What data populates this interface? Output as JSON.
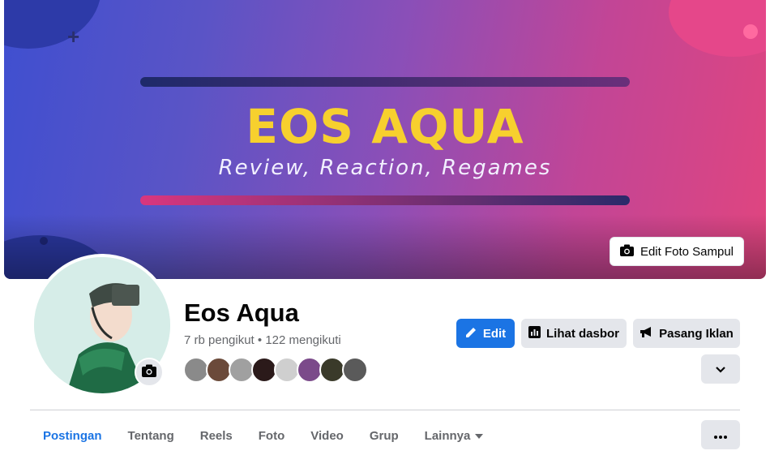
{
  "cover": {
    "title": "EOS AQUA",
    "subtitle": "Review, Reaction, Regames",
    "edit_label": "Edit Foto Sampul"
  },
  "profile": {
    "name": "Eos Aqua",
    "followers_text": "7 rb pengikut • 122 mengikuti"
  },
  "actions": {
    "edit_label": "Edit",
    "dashboard_label": "Lihat dasbor",
    "ads_label": "Pasang Iklan"
  },
  "tabs": [
    {
      "label": "Postingan",
      "active": true
    },
    {
      "label": "Tentang"
    },
    {
      "label": "Reels"
    },
    {
      "label": "Foto"
    },
    {
      "label": "Video"
    },
    {
      "label": "Grup"
    },
    {
      "label": "Lainnya"
    }
  ],
  "friend_avatars": [
    "#8a8a8a",
    "#6b4a3a",
    "#a0a0a0",
    "#2b1a1a",
    "#cfcfcf",
    "#7b4a8a",
    "#3a3a2a",
    "#5a5a5a"
  ],
  "colors": {
    "accent": "#1b74e4",
    "muted_text": "#65676b",
    "button_grey": "#e4e6eb"
  }
}
